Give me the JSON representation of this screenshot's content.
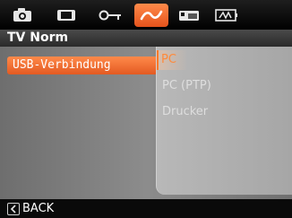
{
  "header": {
    "tabs": [
      {
        "icon": "camera-icon"
      },
      {
        "icon": "video-icon"
      },
      {
        "icon": "key-icon"
      },
      {
        "icon": "connection-icon",
        "active": true
      },
      {
        "icon": "memory-card-icon"
      },
      {
        "icon": "battery-icon"
      }
    ],
    "title": "TV Norm"
  },
  "menu": {
    "selected_item": "USB-Verbindung"
  },
  "submenu": {
    "options": [
      "PC",
      "PC (PTP)",
      "Drucker"
    ],
    "selected": "PC"
  },
  "footer": {
    "back_label": "BACK",
    "back_icon": "chevron-left-icon"
  },
  "colors": {
    "accent": "#f26a2c",
    "panel": "#a6a6a6",
    "background": "#7d7d7d"
  }
}
